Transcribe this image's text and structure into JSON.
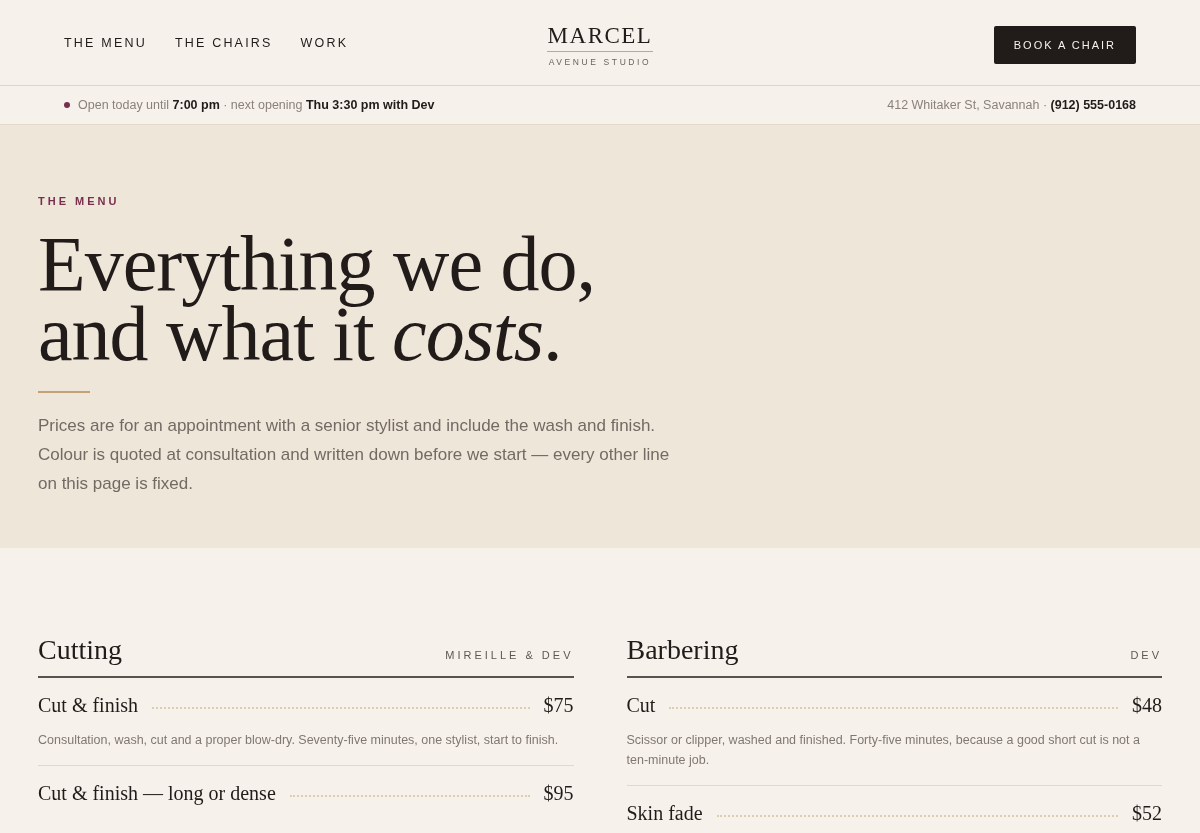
{
  "header": {
    "nav": [
      {
        "label": "THE MENU"
      },
      {
        "label": "THE CHAIRS"
      },
      {
        "label": "WORK"
      }
    ],
    "logo": {
      "name": "MARCEL",
      "subtitle": "AVENUE STUDIO"
    },
    "cta": "BOOK A CHAIR"
  },
  "status_bar": {
    "open": true,
    "hours": "Open today until **7:00 pm** · next opening **Thu 3:30 pm with Dev**",
    "contact": "412 Whitaker St, Savannah · **(912) 555-0168**"
  },
  "hero": {
    "eyebrow": "THE MENU",
    "headline": [
      "Everything we do,",
      "and what it *costs*."
    ],
    "intro": "Prices are for an appointment with a senior stylist and include the wash and finish. Colour is quoted at consultation and written down before we start — every other line on this page is fixed."
  },
  "sections": [
    {
      "title": "Cutting",
      "stylists": "MIREILLE & DEV",
      "items": [
        {
          "name": "Cut & finish",
          "price": "$75",
          "description": "Consultation, wash, cut and a proper blow-dry. Seventy-five minutes, one stylist, start to finish."
        },
        {
          "name": "Cut & finish — long or dense",
          "price": "$95"
        }
      ]
    },
    {
      "title": "Barbering",
      "stylists": "DEV",
      "items": [
        {
          "name": "Cut",
          "price": "$48",
          "description": "Scissor or clipper, washed and finished. Forty-five minutes, because a good short cut is not a ten-minute job."
        },
        {
          "name": "Skin fade",
          "price": "$52"
        }
      ]
    }
  ]
}
